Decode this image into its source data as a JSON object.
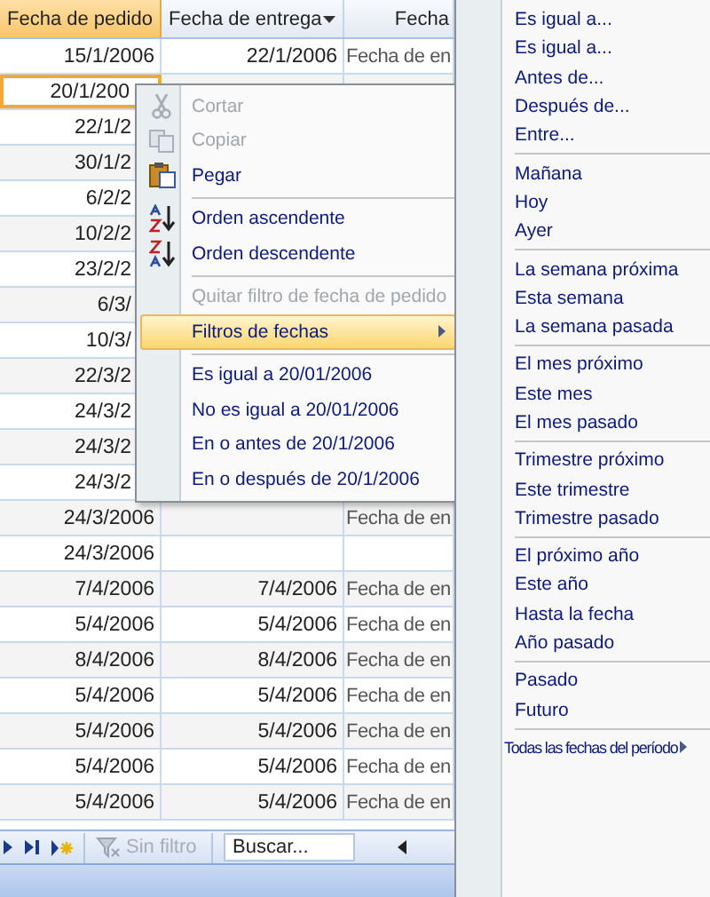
{
  "table": {
    "columns": [
      {
        "label": "Fecha de pedido",
        "selected": true
      },
      {
        "label": "Fecha de entrega",
        "selected": false
      },
      {
        "label": "Fecha",
        "selected": false
      }
    ],
    "rows": [
      {
        "cells": [
          "15/1/2006",
          "22/1/2006",
          "Fecha de en"
        ],
        "selected": false
      },
      {
        "cells": [
          "20/1/200"
        ],
        "selected": true
      },
      {
        "cells": [
          "22/1/2"
        ],
        "selected": false
      },
      {
        "cells": [
          "30/1/2"
        ],
        "selected": false
      },
      {
        "cells": [
          "6/2/2"
        ],
        "selected": false
      },
      {
        "cells": [
          "10/2/2"
        ],
        "selected": false
      },
      {
        "cells": [
          "23/2/2"
        ],
        "selected": false
      },
      {
        "cells": [
          "6/3/"
        ],
        "selected": false
      },
      {
        "cells": [
          "10/3/"
        ],
        "selected": false
      },
      {
        "cells": [
          "22/3/2"
        ],
        "selected": false
      },
      {
        "cells": [
          "24/3/2"
        ],
        "selected": false
      },
      {
        "cells": [
          "24/3/2"
        ],
        "selected": false
      },
      {
        "cells": [
          "24/3/2"
        ],
        "selected": false
      },
      {
        "cells": [
          "24/3/2006",
          null,
          "Fecha de en"
        ],
        "selected": false
      },
      {
        "cells": [
          "24/3/2006",
          null,
          null
        ],
        "selected": false
      },
      {
        "cells": [
          "7/4/2006",
          "7/4/2006",
          "Fecha de en"
        ],
        "selected": false
      },
      {
        "cells": [
          "5/4/2006",
          "5/4/2006",
          "Fecha de en"
        ],
        "selected": false
      },
      {
        "cells": [
          "8/4/2006",
          "8/4/2006",
          "Fecha de en"
        ],
        "selected": false
      },
      {
        "cells": [
          "5/4/2006",
          "5/4/2006",
          "Fecha de en"
        ],
        "selected": false
      },
      {
        "cells": [
          "5/4/2006",
          "5/4/2006",
          "Fecha de en"
        ],
        "selected": false
      },
      {
        "cells": [
          "5/4/2006",
          "5/4/2006",
          "Fecha de en"
        ],
        "selected": false
      },
      {
        "cells": [
          "5/4/2006",
          "5/4/2006",
          "Fecha de en"
        ],
        "selected": false
      }
    ]
  },
  "navigation": {
    "filter": {
      "label": "Sin filtro",
      "disabled": true
    },
    "search": {
      "placeholder": "Buscar..."
    }
  },
  "context_menu": {
    "items": [
      {
        "kind": "item",
        "label": "Cortar",
        "disabled": true,
        "selected": false
      },
      {
        "kind": "item",
        "label": "Copiar",
        "disabled": true,
        "selected": false
      },
      {
        "kind": "item",
        "label": "Pegar",
        "disabled": false,
        "selected": false
      },
      {
        "kind": "separator"
      },
      {
        "kind": "item",
        "label": "Orden ascendente",
        "disabled": false,
        "selected": false
      },
      {
        "kind": "item",
        "label": "Orden descendente",
        "disabled": false,
        "selected": false
      },
      {
        "kind": "separator"
      },
      {
        "kind": "item",
        "label": "Quitar filtro de fecha de pedido",
        "disabled": true,
        "selected": false
      },
      {
        "kind": "submenu",
        "label": "Filtros de fechas",
        "disabled": false,
        "selected": true
      },
      {
        "kind": "separator"
      },
      {
        "kind": "item",
        "label": "Es igual a 20/01/2006",
        "disabled": false,
        "selected": false
      },
      {
        "kind": "item",
        "label": "No es igual a 20/01/2006",
        "disabled": false,
        "selected": false
      },
      {
        "kind": "item",
        "label": "En o antes de 20/1/2006",
        "disabled": false,
        "selected": false
      },
      {
        "kind": "item",
        "label": "En o después de 20/1/2006",
        "disabled": false,
        "selected": false
      }
    ]
  },
  "submenu": {
    "items": [
      {
        "kind": "item",
        "label": "Es igual a..."
      },
      {
        "kind": "item",
        "label": "Es igual a..."
      },
      {
        "kind": "item",
        "label": "Antes de..."
      },
      {
        "kind": "item",
        "label": "Después de..."
      },
      {
        "kind": "item",
        "label": "Entre..."
      },
      {
        "kind": "separator"
      },
      {
        "kind": "item",
        "label": "Mañana"
      },
      {
        "kind": "item",
        "label": "Hoy"
      },
      {
        "kind": "item",
        "label": "Ayer"
      },
      {
        "kind": "separator"
      },
      {
        "kind": "item",
        "label": "La semana próxima"
      },
      {
        "kind": "item",
        "label": "Esta semana"
      },
      {
        "kind": "item",
        "label": "La semana pasada"
      },
      {
        "kind": "separator"
      },
      {
        "kind": "item",
        "label": "El mes próximo"
      },
      {
        "kind": "item",
        "label": "Este mes"
      },
      {
        "kind": "item",
        "label": "El mes pasado"
      },
      {
        "kind": "separator"
      },
      {
        "kind": "item",
        "label": "Trimestre próximo"
      },
      {
        "kind": "item",
        "label": "Este trimestre"
      },
      {
        "kind": "item",
        "label": "Trimestre pasado"
      },
      {
        "kind": "separator"
      },
      {
        "kind": "item",
        "label": "El próximo año"
      },
      {
        "kind": "item",
        "label": "Este año"
      },
      {
        "kind": "item",
        "label": "Hasta la fecha"
      },
      {
        "kind": "item",
        "label": "Año pasado"
      },
      {
        "kind": "separator"
      },
      {
        "kind": "item",
        "label": "Pasado"
      },
      {
        "kind": "item",
        "label": "Futuro"
      },
      {
        "kind": "separator"
      },
      {
        "kind": "submenu",
        "label": "Todas las fechas del período"
      }
    ]
  }
}
